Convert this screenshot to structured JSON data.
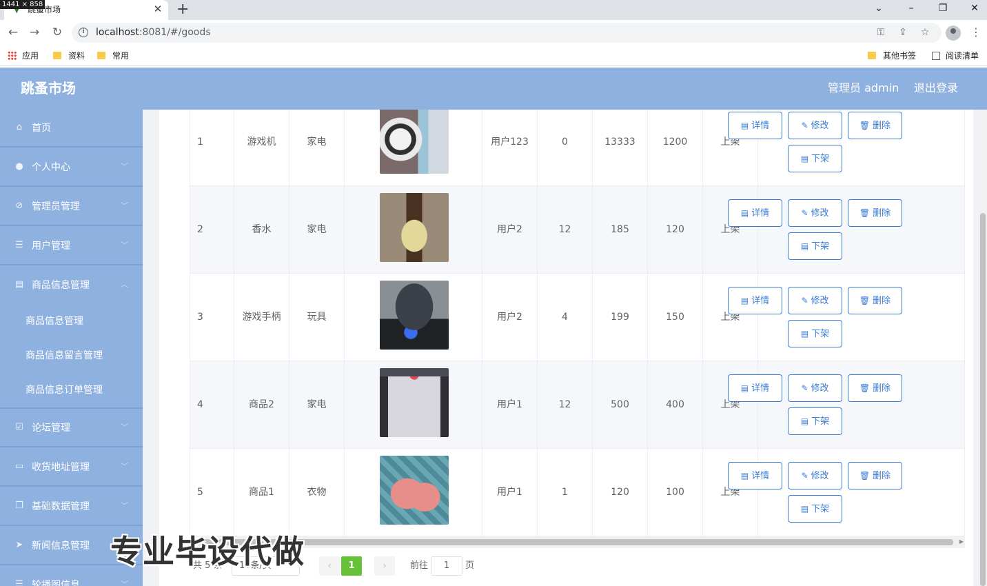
{
  "dim_badge": "1441 × 858",
  "browser": {
    "tab_title": "跳蚤市场",
    "url_host": "localhost",
    "url_path": ":8081/#/goods",
    "bookmarks": {
      "apps": "应用",
      "folder1": "资料",
      "folder2": "常用",
      "other": "其他书签",
      "reading": "阅读清单"
    }
  },
  "app": {
    "title": "跳蚤市场",
    "user": "管理员 admin",
    "logout": "退出登录"
  },
  "sidebar": {
    "items": [
      {
        "label": "首页",
        "icon": "home-icon",
        "arrow": false
      },
      {
        "label": "个人中心",
        "icon": "user-icon",
        "arrow": true
      },
      {
        "label": "管理员管理",
        "icon": "bell-off-icon",
        "arrow": true
      },
      {
        "label": "用户管理",
        "icon": "list-icon",
        "arrow": true
      },
      {
        "label": "商品信息管理",
        "icon": "document-icon",
        "arrow": true,
        "expanded": true
      },
      {
        "label": "论坛管理",
        "icon": "chart-icon",
        "arrow": true
      },
      {
        "label": "收货地址管理",
        "icon": "address-icon",
        "arrow": true
      },
      {
        "label": "基础数据管理",
        "icon": "copy-icon",
        "arrow": true
      },
      {
        "label": "新闻信息管理",
        "icon": "send-icon",
        "arrow": true
      },
      {
        "label": "轮播图信息",
        "icon": "menu-icon",
        "arrow": true
      }
    ],
    "sub_items": [
      "商品信息管理",
      "商品信息留言管理",
      "商品信息订单管理"
    ]
  },
  "table": {
    "rows": [
      {
        "index": "1",
        "name": "游戏机",
        "category": "家电",
        "image": "game-console",
        "owner": "用户123",
        "stock": "0",
        "original_price": "13333",
        "price": "1200",
        "status": "上架"
      },
      {
        "index": "2",
        "name": "香水",
        "category": "家电",
        "image": "perfume",
        "owner": "用户2",
        "stock": "12",
        "original_price": "185",
        "price": "120",
        "status": "上架"
      },
      {
        "index": "3",
        "name": "游戏手柄",
        "category": "玩具",
        "image": "gamepad",
        "owner": "用户2",
        "stock": "4",
        "original_price": "199",
        "price": "150",
        "status": "上架"
      },
      {
        "index": "4",
        "name": "商品2",
        "category": "家电",
        "image": "fridge",
        "owner": "用户1",
        "stock": "12",
        "original_price": "500",
        "price": "400",
        "status": "上架"
      },
      {
        "index": "5",
        "name": "商品1",
        "category": "衣物",
        "image": "pink-pants",
        "owner": "用户1",
        "stock": "1",
        "original_price": "120",
        "price": "100",
        "status": "上架"
      }
    ],
    "buttons": {
      "detail": "详情",
      "edit": "修改",
      "delete": "删除",
      "unlist": "下架"
    }
  },
  "pagination": {
    "total_prefix": "共 5 条",
    "page_size": "10条/页",
    "current": "1",
    "goto_label": "前往",
    "goto_value": "1",
    "page_suffix": "页"
  },
  "watermark": "专业毕设代做",
  "colors": {
    "accent": "#8fb1e0",
    "button": "#3a7bd5",
    "active_page": "#67c23a"
  }
}
